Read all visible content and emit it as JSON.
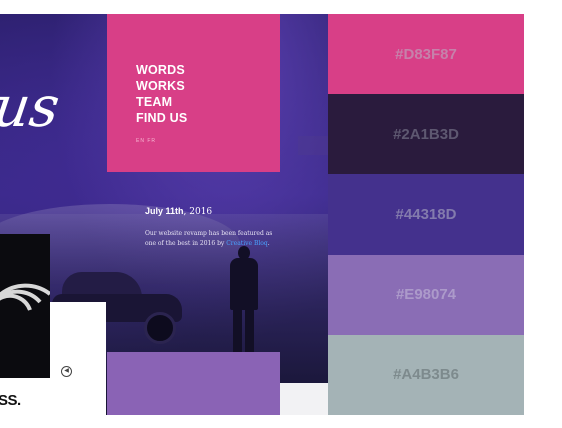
{
  "hero": {
    "script_title": "us"
  },
  "nav": {
    "items": [
      "WORDS",
      "WORKS",
      "TEAM",
      "FIND US"
    ],
    "lang": "EN  FR"
  },
  "post": {
    "date_bold": "July 11th",
    "date_rest": ", 2016",
    "body": "Our website revamp has been featured as one of the best in 2016 by ",
    "link": "Creative Bloq",
    "body_end": "."
  },
  "misc": {
    "bottom_word": "SS.",
    "circle_glyph": "◀"
  },
  "palette": [
    {
      "hex": "#D83F87",
      "label": "#D83F87",
      "text_color": "#b8b8c8"
    },
    {
      "hex": "#2A1B3D",
      "label": "#2A1B3D",
      "text_color": "#8a8a9c"
    },
    {
      "hex": "#44318D",
      "label": "#44318D",
      "text_color": "#b8b8c8"
    },
    {
      "hex": "#8A6DB5",
      "label": "#E98074",
      "text_color": "#c8c0dc"
    },
    {
      "hex": "#A4B3B6",
      "label": "#A4B3B6",
      "text_color": "#5e6a6c"
    }
  ]
}
